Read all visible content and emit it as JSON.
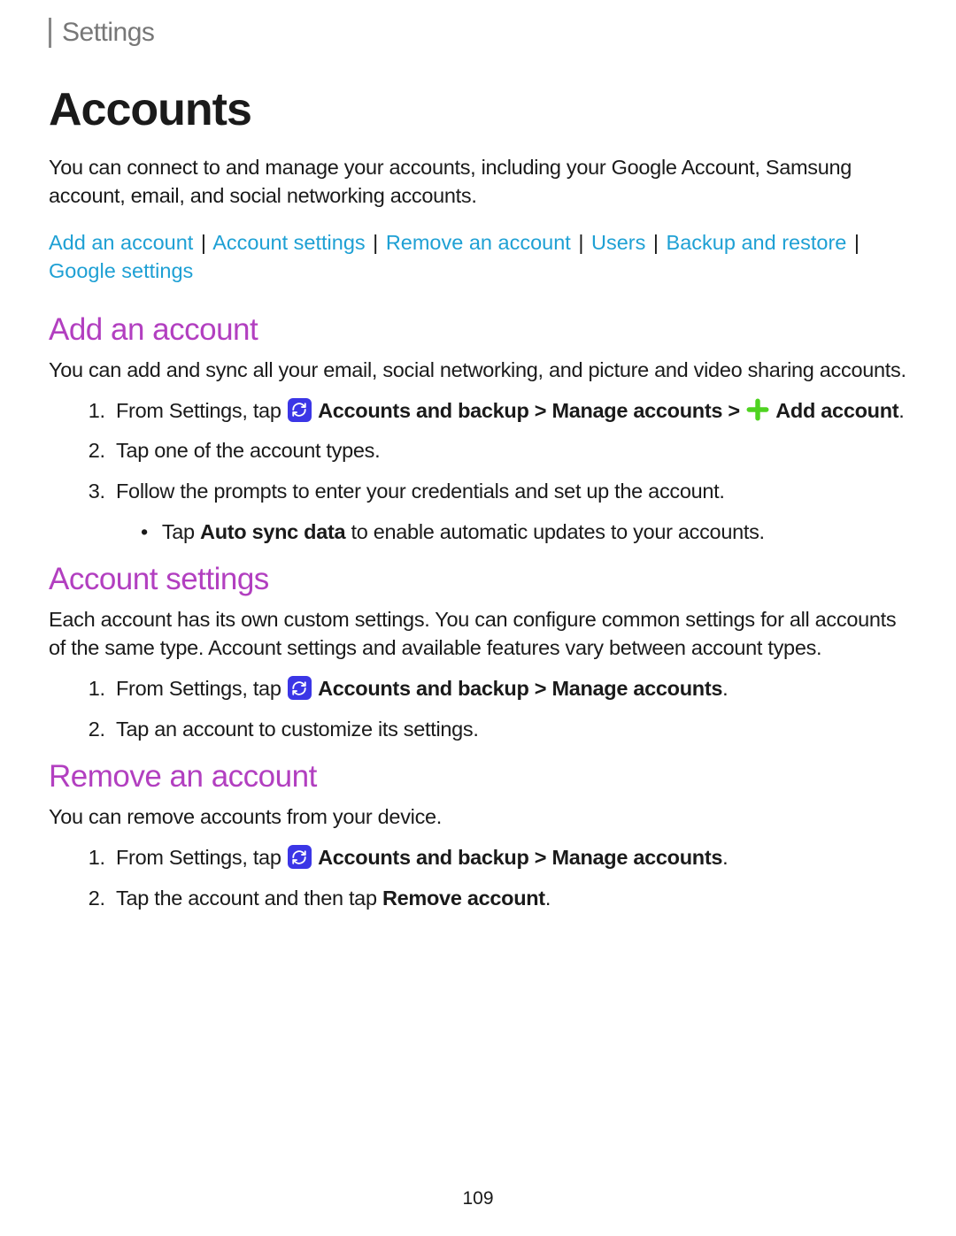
{
  "breadcrumb": "Settings",
  "title": "Accounts",
  "intro": "You can connect to and manage your accounts, including your Google Account, Samsung account, email, and social networking accounts.",
  "toc": {
    "add_account": "Add an account",
    "account_settings": "Account settings",
    "remove_account": "Remove an account",
    "users": "Users",
    "backup_restore": "Backup and restore",
    "google_settings": "Google settings",
    "sep": "|"
  },
  "sections": {
    "add": {
      "heading": "Add an account",
      "body": "You can add and sync all your email, social networking, and picture and video sharing accounts.",
      "step1": {
        "prefix": "From Settings, tap ",
        "b1": "Accounts and backup",
        "gt1": " > ",
        "b2": "Manage accounts",
        "gt2": " > ",
        "b3": "Add account",
        "period": "."
      },
      "step2": "Tap one of the account types.",
      "step3": "Follow the prompts to enter your credentials and set up the account.",
      "sub1_prefix": "Tap ",
      "sub1_bold": "Auto sync data",
      "sub1_suffix": " to enable automatic updates to your accounts."
    },
    "settings": {
      "heading": "Account settings",
      "body": "Each account has its own custom settings. You can configure common settings for all accounts of the same type. Account settings and available features vary between account types.",
      "step1": {
        "prefix": "From Settings, tap ",
        "b1": "Accounts and backup",
        "gt1": " > ",
        "b2": "Manage accounts",
        "period": "."
      },
      "step2": "Tap an account to customize its settings."
    },
    "remove": {
      "heading": "Remove an account",
      "body": "You can remove accounts from your device.",
      "step1": {
        "prefix": "From Settings, tap ",
        "b1": "Accounts and backup",
        "gt1": " > ",
        "b2": "Manage accounts",
        "period": "."
      },
      "step2_prefix": "Tap the account and then tap ",
      "step2_bold": "Remove account",
      "step2_suffix": "."
    }
  },
  "page_number": "109"
}
